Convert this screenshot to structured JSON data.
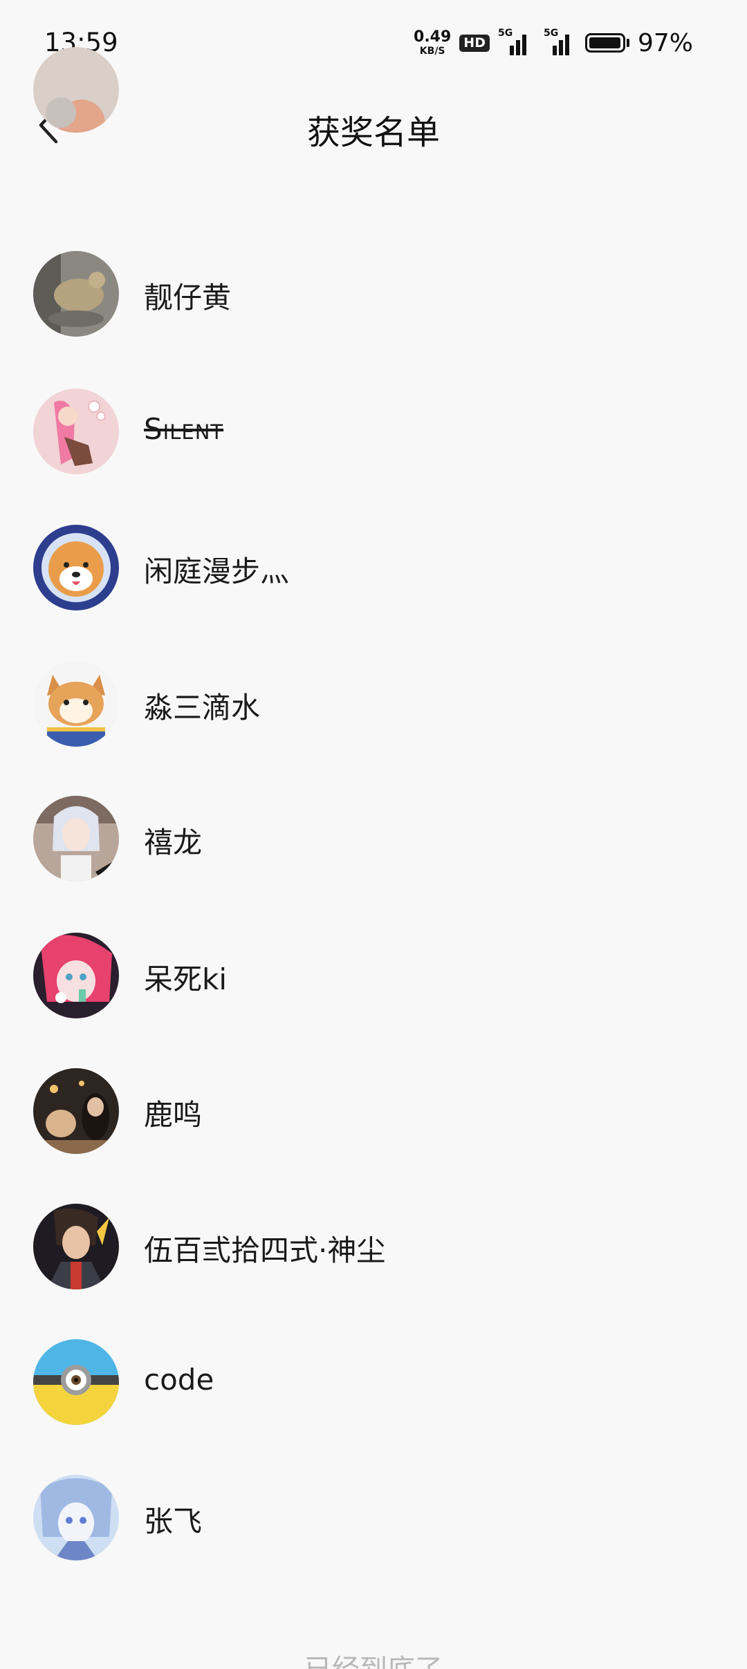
{
  "status_bar": {
    "time": "13:59",
    "net_speed_value": "0.49",
    "net_speed_unit": "KB/S",
    "hd_badge": "HD",
    "signal1_label": "5G",
    "signal2_label": "5G",
    "battery_percent": "97%",
    "battery_level": 0.97
  },
  "nav": {
    "title": "获奖名单",
    "back_icon": "chevron-left-icon"
  },
  "winners": [
    {
      "name": "",
      "avatar": "partial-avatar"
    },
    {
      "name": "靓仔黄",
      "avatar": "bird-photo"
    },
    {
      "name": "Silent",
      "avatar": "pink-anime-girl",
      "strike": true
    },
    {
      "name": "闲庭漫步灬",
      "avatar": "shiba-astronaut"
    },
    {
      "name": "淼三滴水",
      "avatar": "shiba-cartoon"
    },
    {
      "name": "禧龙",
      "avatar": "silver-hair-girl"
    },
    {
      "name": "呆死ki",
      "avatar": "red-hair-anime"
    },
    {
      "name": "鹿鸣",
      "avatar": "night-photo"
    },
    {
      "name": "伍百弎拾四式·神尘",
      "avatar": "anime-fighter"
    },
    {
      "name": "code",
      "avatar": "minion"
    },
    {
      "name": "张飞",
      "avatar": "blue-anime"
    }
  ],
  "footer": {
    "end_text": "已经到底了"
  },
  "colors": {
    "background": "#f8f8f8",
    "text": "#1a1a1a",
    "footer_text": "#b8b8b8"
  }
}
